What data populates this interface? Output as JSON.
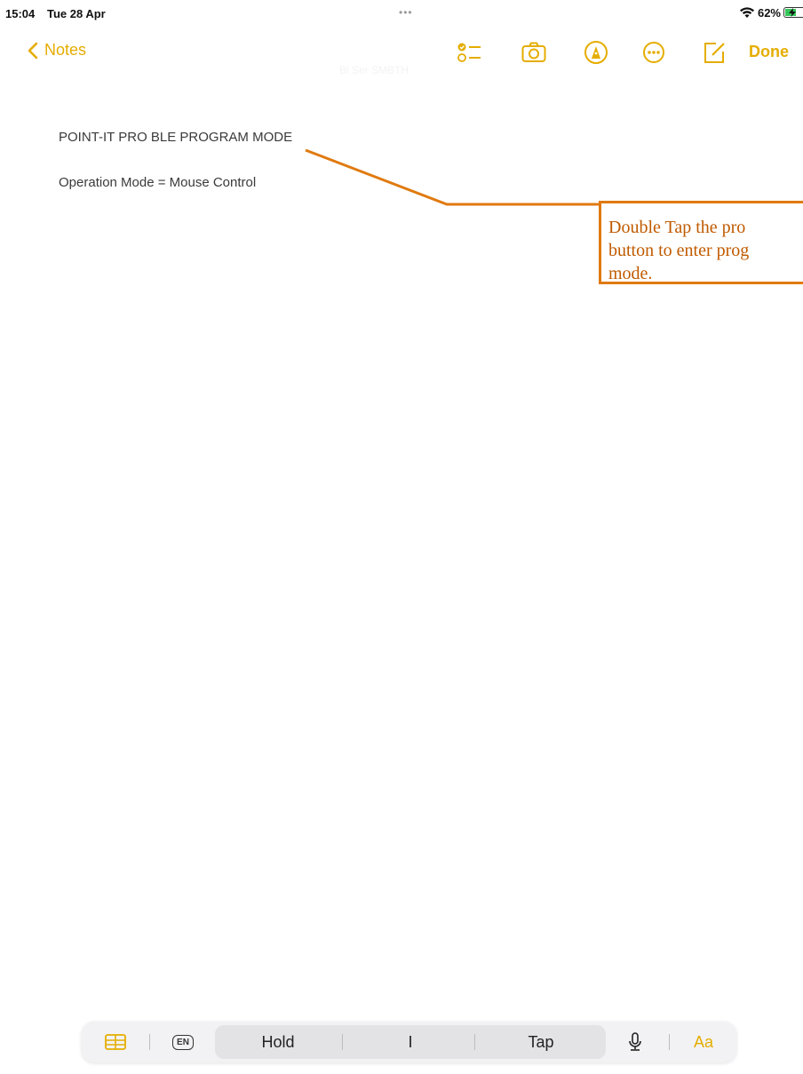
{
  "status_bar": {
    "time": "15:04",
    "date": "Tue 28 Apr",
    "multitask_dots": "•••",
    "battery_percent": "62%",
    "battery_level": 0.62,
    "charging": true
  },
  "toolbar": {
    "back_label": "Notes",
    "done_label": "Done",
    "accent_color": "#e5ad00",
    "icons": [
      "checklist-icon",
      "camera-icon",
      "markup-pen-icon",
      "more-ellipsis-icon",
      "compose-icon"
    ]
  },
  "note": {
    "faint_title": "Bl Ser SMBTH",
    "title": "POINT-IT PRO BLE PROGRAM MODE",
    "line1": "Operation Mode = Mouse Control"
  },
  "callout": {
    "text": "Double Tap the pro\nbutton to enter prog\nmode.",
    "color": "#e07a10"
  },
  "keyboard_bar": {
    "language_badge": "EN",
    "predictions": [
      "Hold",
      "I",
      "Tap"
    ],
    "format_label": "Aa",
    "icons": [
      "table-icon",
      "language-icon",
      "microphone-icon"
    ]
  }
}
